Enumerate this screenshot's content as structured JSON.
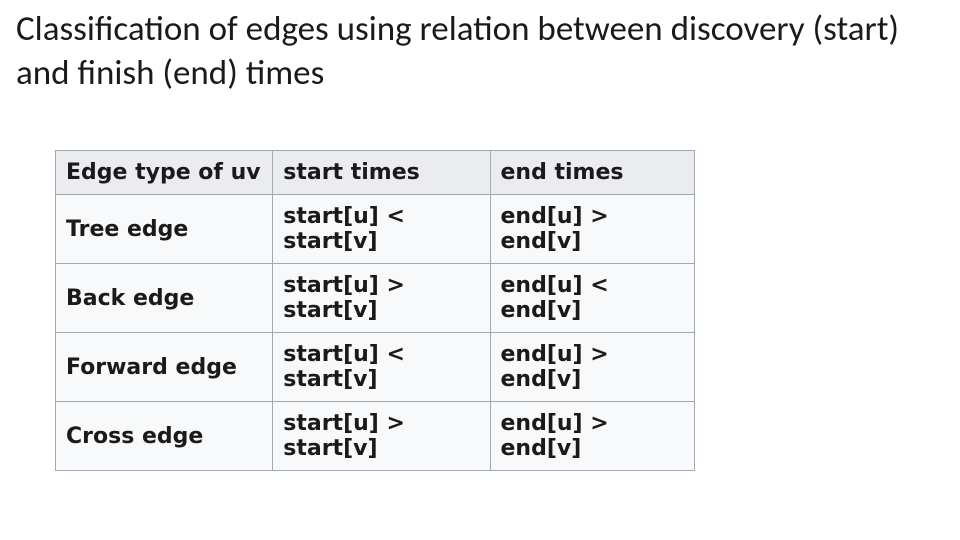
{
  "title": "Classification of edges using relation between discovery (start) and finish (end) times",
  "table": {
    "headers": [
      "Edge type of uv",
      "start times",
      "end times"
    ],
    "rows": [
      {
        "type": "Tree edge",
        "start": "start[u] < start[v]",
        "end": "end[u] > end[v]"
      },
      {
        "type": "Back edge",
        "start": "start[u] > start[v]",
        "end": "end[u] < end[v]"
      },
      {
        "type": "Forward edge",
        "start": "start[u] < start[v]",
        "end": "end[u] > end[v]"
      },
      {
        "type": "Cross edge",
        "start": "start[u] > start[v]",
        "end": "end[u] > end[v]"
      }
    ]
  }
}
